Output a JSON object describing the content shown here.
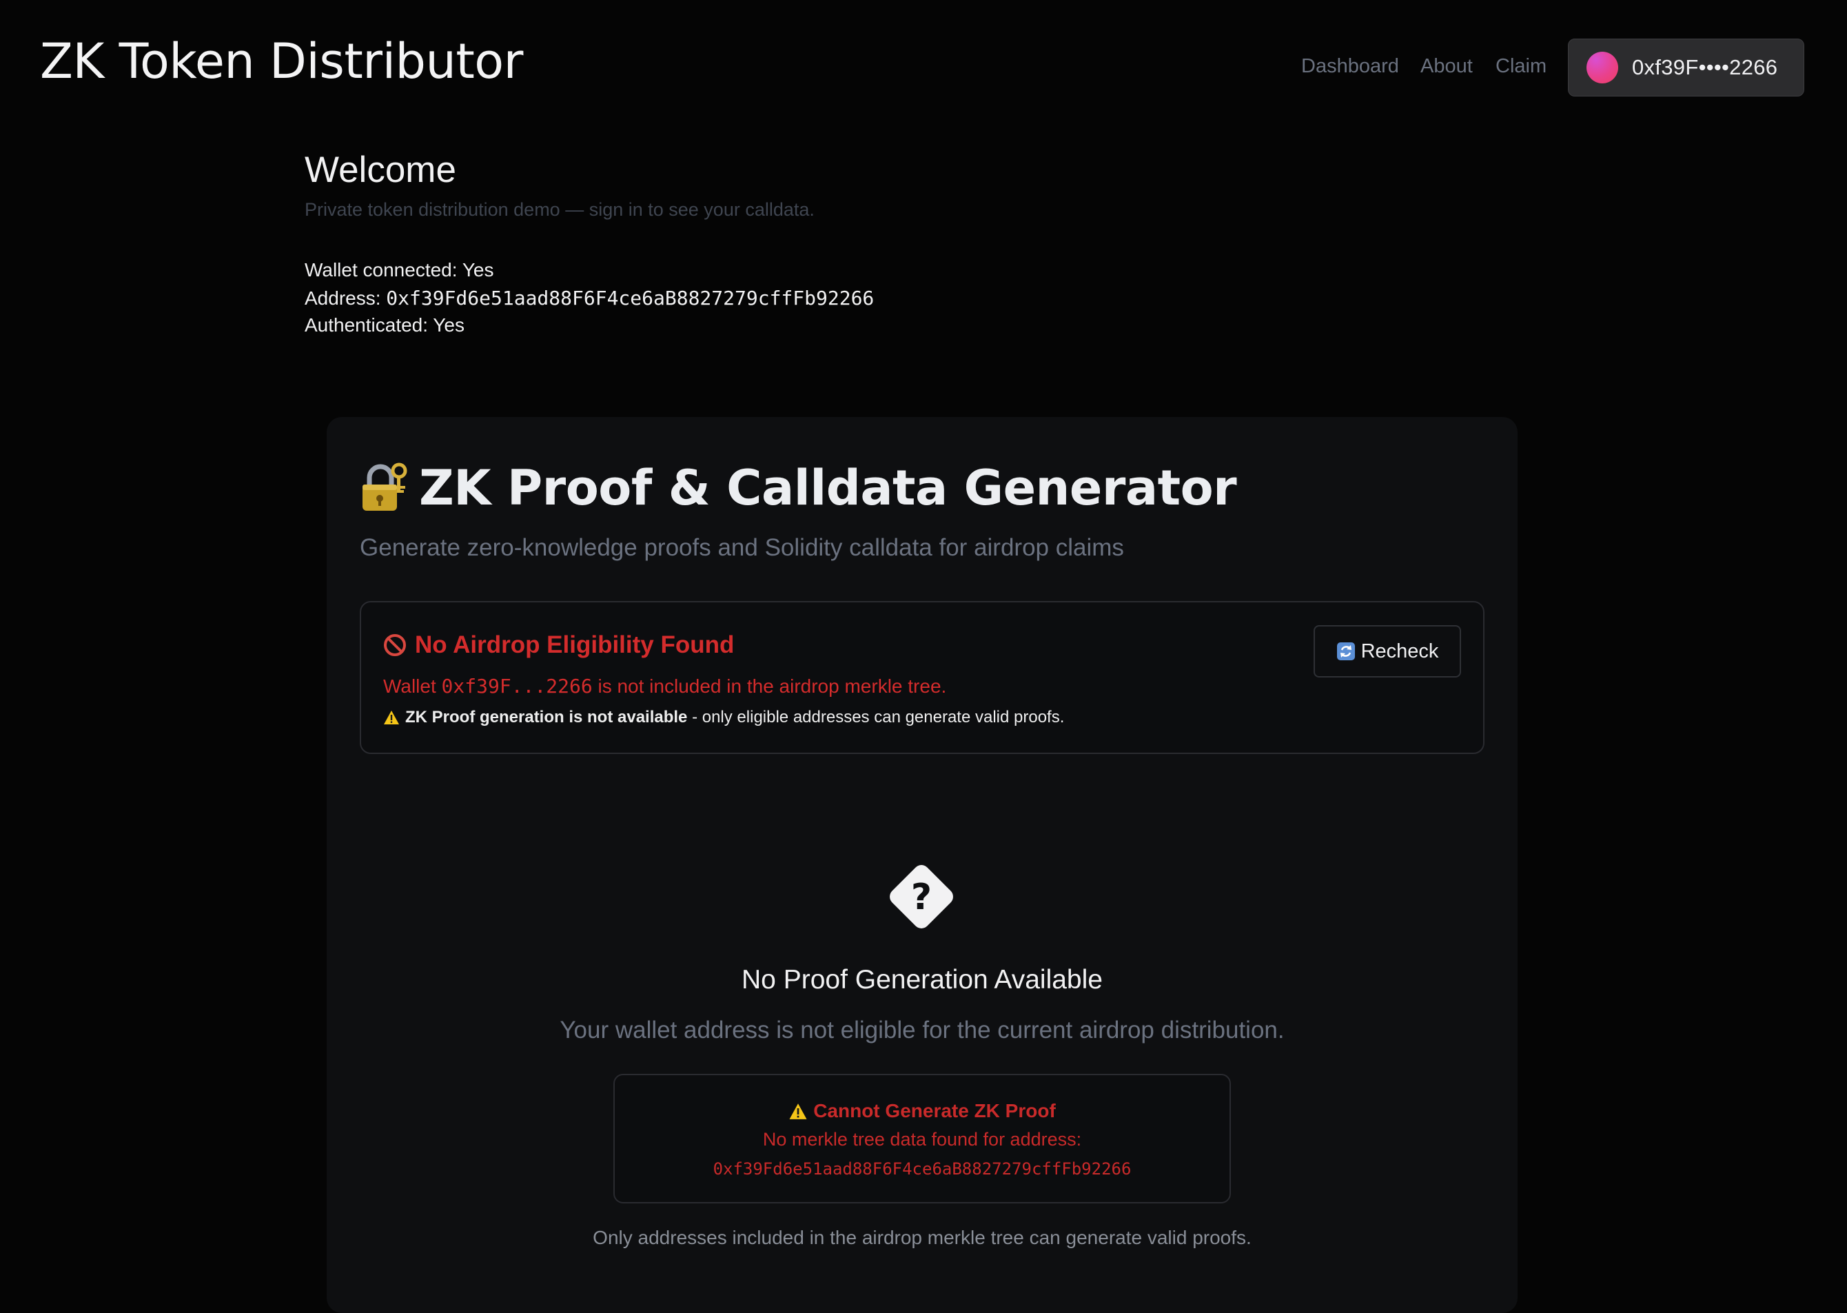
{
  "header": {
    "app_title": "ZK Token Distributor",
    "nav": [
      {
        "label": "Dashboard"
      },
      {
        "label": "About"
      },
      {
        "label": "Claim"
      }
    ],
    "wallet_label": "0xf39F••••2266"
  },
  "welcome": {
    "title": "Welcome",
    "subtitle": "Private token distribution demo — sign in to see your calldata.",
    "wallet_connected_label": "Wallet connected: ",
    "wallet_connected_value": "Yes",
    "address_label": "Address: ",
    "address_value": "0xf39Fd6e51aad88F6F4ce6aB8827279cffFb92266",
    "authenticated_label": "Authenticated: ",
    "authenticated_value": "Yes"
  },
  "card": {
    "title": "ZK Proof & Calldata Generator",
    "subtitle": "Generate zero-knowledge proofs and Solidity calldata for airdrop claims",
    "alert": {
      "title": "No Airdrop Eligibility Found",
      "msg_prefix": "Wallet ",
      "msg_address": "0xf39F...2266",
      "msg_suffix": " is not included in the airdrop merkle tree.",
      "note_bold": "ZK Proof generation is not available",
      "note_rest": " - only eligible addresses can generate valid proofs.",
      "recheck_label": "Recheck"
    },
    "empty": {
      "title": "No Proof Generation Available",
      "subtitle": "Your wallet address is not eligible for the current airdrop distribution.",
      "error_title": "Cannot Generate ZK Proof",
      "error_line": "No merkle tree data found for address:",
      "error_address": "0xf39Fd6e51aad88F6F4ce6aB8827279cffFb92266",
      "footer": "Only addresses included in the airdrop merkle tree can generate valid proofs."
    }
  },
  "colors": {
    "background": "#050505",
    "card": "#0e0f11",
    "error_red": "#d42c2c",
    "muted": "#6b7280",
    "wallet_button": "#2c2c2e"
  },
  "icons": [
    "lock-with-key-icon",
    "no-entry-icon",
    "warning-icon",
    "refresh-icon",
    "question-diamond-icon",
    "wallet-avatar"
  ]
}
